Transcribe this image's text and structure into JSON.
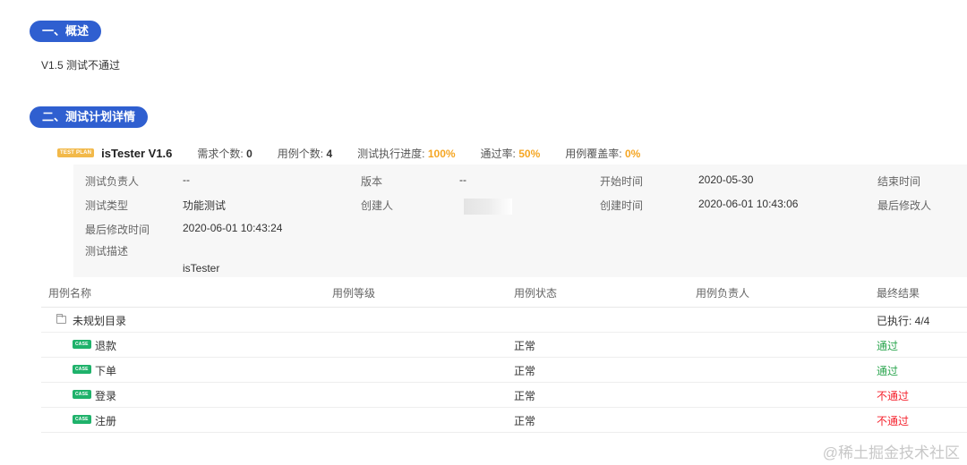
{
  "section1": {
    "title": "一、概述",
    "desc": "V1.5 测试不通过"
  },
  "section2": {
    "title": "二、测试计划详情"
  },
  "plan": {
    "badge": "TEST PLAN",
    "name": "isTester V1.6",
    "stats": [
      {
        "label": "需求个数:",
        "value": "0",
        "highlight": false
      },
      {
        "label": "用例个数:",
        "value": "4",
        "highlight": false
      },
      {
        "label": "测试执行进度:",
        "value": "100%",
        "highlight": true
      },
      {
        "label": "通过率:",
        "value": "50%",
        "highlight": true
      },
      {
        "label": "用例覆盖率:",
        "value": "0%",
        "highlight": true
      }
    ]
  },
  "info": {
    "owner_label": "测试负责人",
    "owner_value": "--",
    "version_label": "版本",
    "version_value": "--",
    "start_label": "开始时间",
    "start_value": "2020-05-30",
    "end_label": "结束时间",
    "type_label": "测试类型",
    "type_value": "功能测试",
    "creator_label": "创建人",
    "created_label": "创建时间",
    "created_value": "2020-06-01 10:43:06",
    "last_modifier_label": "最后修改人",
    "modified_label": "最后修改时间",
    "modified_value": "2020-06-01 10:43:24",
    "desc_label": "测试描述",
    "desc_value": "isTester"
  },
  "table": {
    "headers": {
      "name": "用例名称",
      "level": "用例等级",
      "status": "用例状态",
      "owner": "用例负责人",
      "result": "最终结果"
    },
    "folder": {
      "name": "未规划目录",
      "result": "已执行: 4/4"
    },
    "case_badge": "CASE",
    "rows": [
      {
        "name": "退款",
        "status": "正常",
        "result": "通过"
      },
      {
        "name": "下单",
        "status": "正常",
        "result": "通过"
      },
      {
        "name": "登录",
        "status": "正常",
        "result": "不通过"
      },
      {
        "name": "注册",
        "status": "正常",
        "result": "不通过"
      }
    ]
  },
  "watermark": "@稀土掘金技术社区",
  "colors": {
    "accent": "#2f5fd0",
    "highlight": "#f5a623",
    "pass": "#2aa54e",
    "fail": "#f5222d",
    "case_badge": "#1fb26b"
  }
}
